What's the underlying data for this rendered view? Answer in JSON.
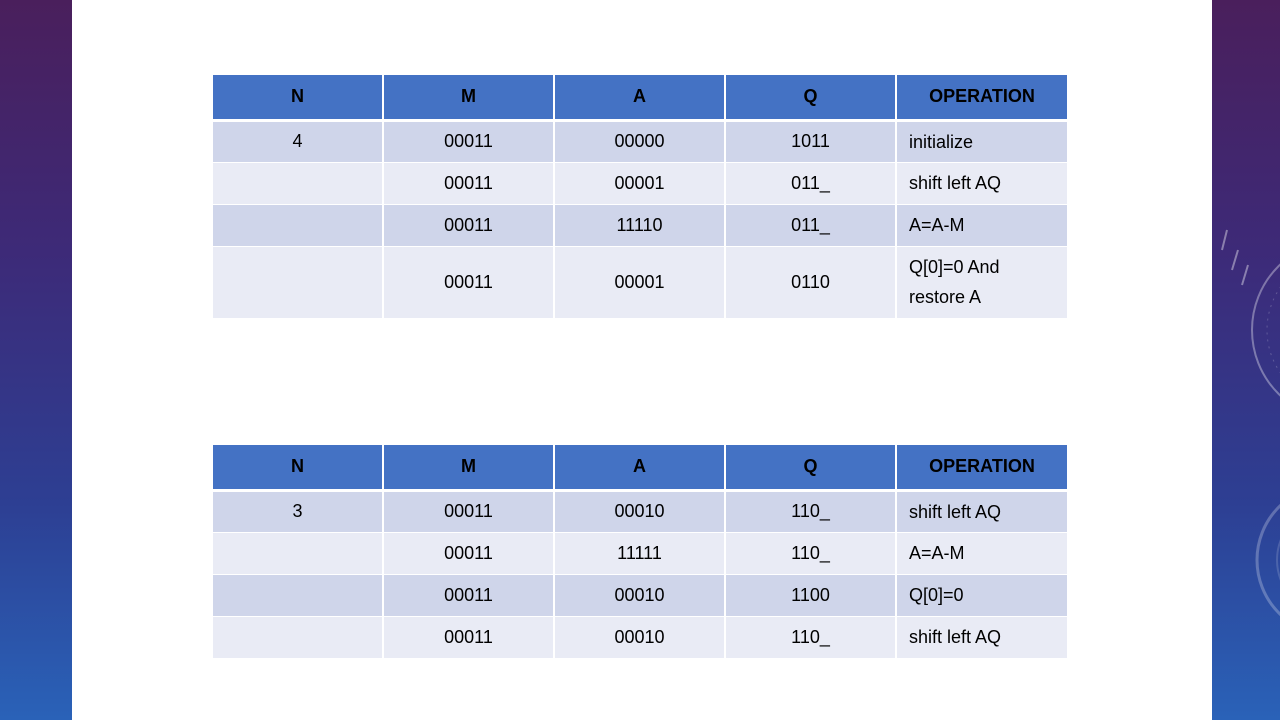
{
  "tables": [
    {
      "headers": [
        "N",
        "M",
        "A",
        "Q",
        "OPERATION"
      ],
      "rows": [
        {
          "n": "4",
          "m": "00011",
          "a": "00000",
          "q": "1011",
          "op": "initialize"
        },
        {
          "n": "",
          "m": "00011",
          "a": "00001",
          "q": "011_",
          "op": "shift left AQ"
        },
        {
          "n": "",
          "m": "00011",
          "a": "11110",
          "q": "011_",
          "op": "A=A-M"
        },
        {
          "n": "",
          "m": "00011",
          "a": "00001",
          "q": "0110",
          "op": "Q[0]=0 And restore A"
        }
      ]
    },
    {
      "headers": [
        "N",
        "M",
        "A",
        "Q",
        "OPERATION"
      ],
      "rows": [
        {
          "n": "3",
          "m": "00011",
          "a": "00010",
          "q": "110_",
          "op": "shift left AQ"
        },
        {
          "n": "",
          "m": "00011",
          "a": "11111",
          "q": "110_",
          "op": "A=A-M"
        },
        {
          "n": "",
          "m": "00011",
          "a": "00010",
          "q": "1100",
          "op": "Q[0]=0"
        },
        {
          "n": "",
          "m": "00011",
          "a": "00010",
          "q": "110_",
          "op": "shift left AQ"
        }
      ]
    }
  ],
  "theme": {
    "header_color": "#4472c4",
    "row_dark": "#cfd5ea",
    "row_light": "#e9ebf5"
  }
}
